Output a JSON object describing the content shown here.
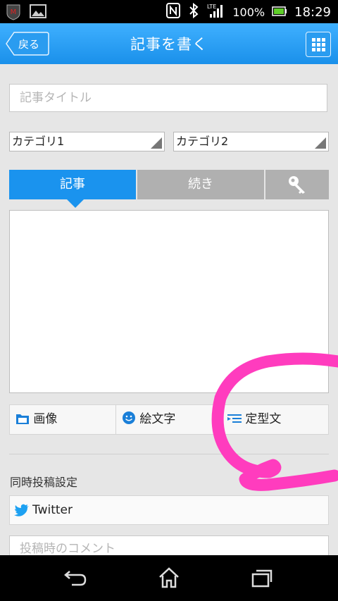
{
  "status": {
    "battery": "100%",
    "time": "18:29",
    "network": "LTE"
  },
  "header": {
    "back_label": "戻る",
    "title": "記事を書く"
  },
  "form": {
    "title_placeholder": "記事タイトル",
    "category1": "カテゴリ1",
    "category2": "カテゴリ2"
  },
  "tabs": [
    {
      "label": "記事"
    },
    {
      "label": "続き"
    }
  ],
  "toolbar": {
    "image_label": "画像",
    "emoji_label": "絵文字",
    "template_label": "定型文"
  },
  "share": {
    "section_label": "同時投稿設定",
    "twitter_label": "Twitter",
    "comment_placeholder": "投稿時のコメント"
  },
  "colors": {
    "accent": "#1a93ee",
    "annotation": "#ff3cbe"
  }
}
